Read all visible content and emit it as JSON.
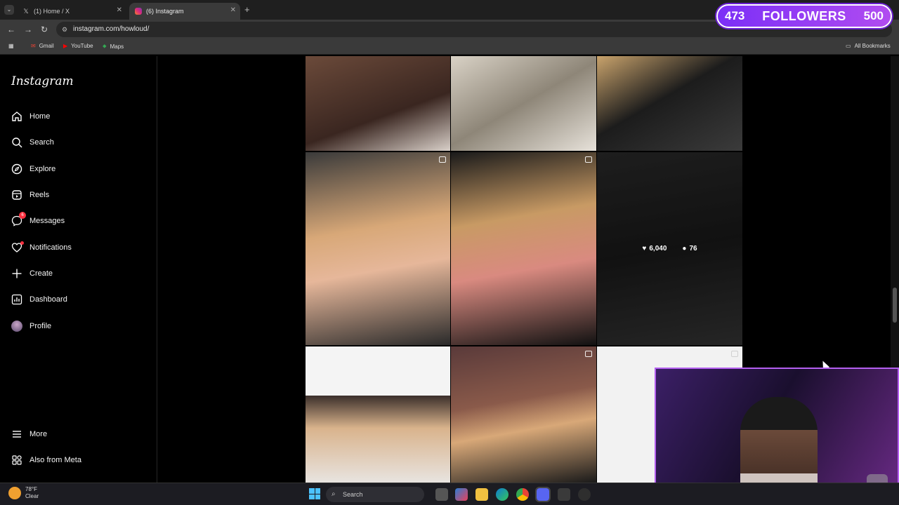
{
  "browser": {
    "tabs": [
      {
        "title": "(1) Home / X",
        "favicon": "x-logo-icon",
        "active": false
      },
      {
        "title": "(6) Instagram",
        "favicon": "instagram-icon",
        "active": true
      }
    ],
    "new_tab": "+",
    "url": "instagram.com/howloud/",
    "bookmarks": [
      {
        "label": "Gmail",
        "icon": "gmail-icon"
      },
      {
        "label": "YouTube",
        "icon": "youtube-icon"
      },
      {
        "label": "Maps",
        "icon": "maps-icon"
      }
    ],
    "all_bookmarks": "All Bookmarks"
  },
  "instagram": {
    "logo": "Instagram",
    "nav": [
      {
        "label": "Home",
        "icon": "home-icon"
      },
      {
        "label": "Search",
        "icon": "search-icon"
      },
      {
        "label": "Explore",
        "icon": "compass-icon"
      },
      {
        "label": "Reels",
        "icon": "reels-icon"
      },
      {
        "label": "Messages",
        "icon": "messenger-icon",
        "badge": "6"
      },
      {
        "label": "Notifications",
        "icon": "heart-icon",
        "dot": true
      },
      {
        "label": "Create",
        "icon": "plus-icon"
      },
      {
        "label": "Dashboard",
        "icon": "dashboard-icon"
      },
      {
        "label": "Profile",
        "icon": "avatar-icon"
      }
    ],
    "bottom_nav": [
      {
        "label": "More",
        "icon": "menu-icon"
      },
      {
        "label": "Also from Meta",
        "icon": "meta-icon"
      }
    ],
    "hover_post": {
      "likes": "6,040",
      "comments": "76"
    }
  },
  "overlay": {
    "followers_current": "473",
    "followers_label": "FOLLOWERS",
    "followers_goal": "500"
  },
  "taskbar": {
    "weather_temp": "78°F",
    "weather_cond": "Clear",
    "search_placeholder": "Search"
  },
  "colors": {
    "accent_notification": "#ff3040",
    "stream_purple": "#7b2ff7",
    "windows_blue": "#4cc2ff"
  }
}
